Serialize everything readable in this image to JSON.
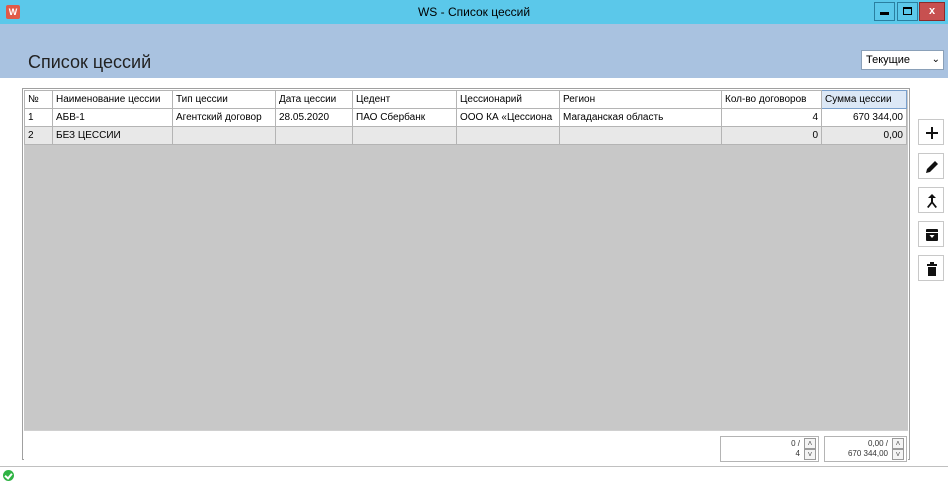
{
  "window": {
    "title": "WS - Список цессий",
    "app_icon_text": "W"
  },
  "page": {
    "title": "Список цессий"
  },
  "filter": {
    "selected": "Текущие",
    "chevron_icon": "chevron-down-icon"
  },
  "grid": {
    "columns": [
      "№",
      "Наименование цессии",
      "Тип цессии",
      "Дата цессии",
      "Цедент",
      "Цессионарий",
      "Регион",
      "Кол-во договоров",
      "Сумма цессии"
    ],
    "selected_column": "Сумма цессии",
    "rows": [
      [
        "1",
        "АБВ-1",
        "Агентский договор",
        "28.05.2020",
        "ПАО Сбербанк",
        "ООО КА «Цессиона",
        "Магаданская область",
        "4",
        "670 344,00"
      ],
      [
        "2",
        "БЕЗ ЦЕССИИ",
        "",
        "",
        "",
        "",
        "",
        "0",
        "0,00"
      ]
    ]
  },
  "summary": {
    "count_top": "0 /",
    "count_bottom": "4",
    "sum_top": "0,00 /",
    "sum_bottom": "670 344,00"
  },
  "toolbar": {
    "buttons": [
      "add-icon",
      "edit-icon",
      "merge-icon",
      "archive-icon",
      "delete-icon"
    ]
  },
  "colors": {
    "titlebar": "#5bc8ea",
    "header_band": "#a9c2e0",
    "grid_background": "#c8c8c8",
    "status_ok": "#2fb344"
  }
}
